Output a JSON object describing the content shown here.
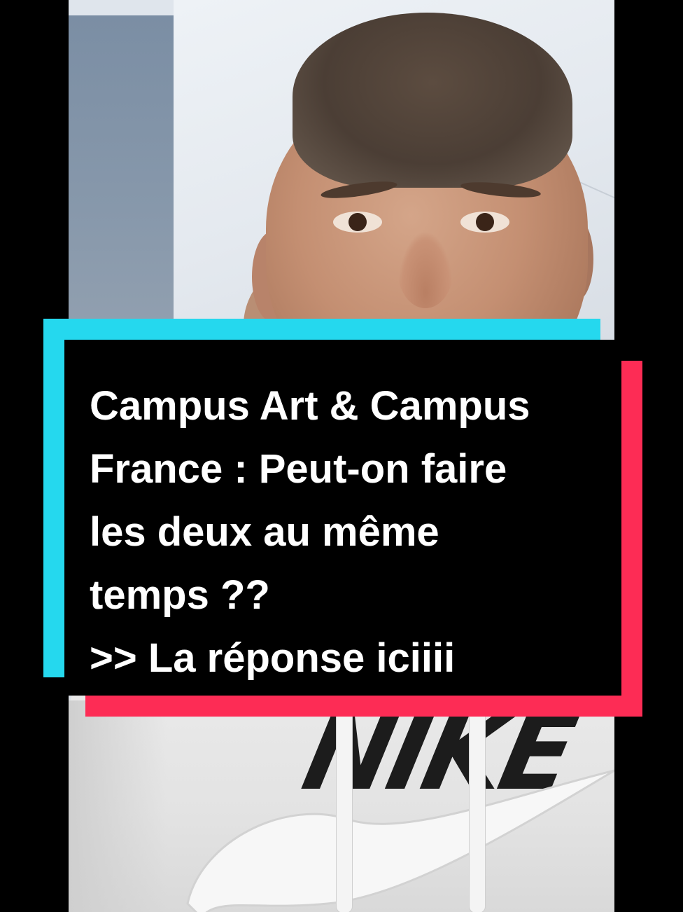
{
  "video": {
    "garment_brand": "NIKE"
  },
  "caption": {
    "lines": [
      "Campus Art & Campus",
      "France : Peut-on faire",
      "les deux au même",
      "temps ??",
      ">> La réponse iciiii"
    ]
  },
  "colors": {
    "caption_background": "#000000",
    "caption_text": "#ffffff",
    "accent_cyan": "#25d8ee",
    "accent_red": "#fd2c55"
  }
}
